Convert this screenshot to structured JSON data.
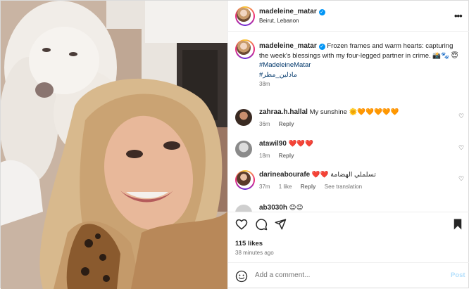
{
  "colors": {
    "accent": "#0095f6",
    "hashtag": "#00376b",
    "muted": "#737373",
    "heart": "#ed4956",
    "post_disabled": "#b2dffc"
  },
  "post": {
    "username": "madeleine_matar",
    "location": "Beirut, Lebanon",
    "more_icon": "•••"
  },
  "caption": {
    "username": "madeleine_matar",
    "text": "Frozen frames and warm hearts: capturing the week's blessings with my four-legged partner in crime. 📸🐾 😇",
    "hashtags": [
      "#MadeleineMatar",
      "#مادلين_مطر"
    ],
    "time": "38m"
  },
  "comments": [
    {
      "username": "zahraa.h.hallal",
      "text": "My sunshine 🌞🧡🧡🧡🧡🧡",
      "time": "36m",
      "likes": "",
      "reply": "Reply",
      "translate": ""
    },
    {
      "username": "atawil90",
      "text": "❤️❤️❤️",
      "time": "18m",
      "likes": "",
      "reply": "Reply",
      "translate": ""
    },
    {
      "username": "darineabourafe",
      "text": "❤️❤️ تسلملي الهضامة",
      "time": "37m",
      "likes": "1 like",
      "reply": "Reply",
      "translate": "See translation"
    },
    {
      "username": "ab3030h",
      "text": "😊😊",
      "time": "",
      "likes": "",
      "reply": "",
      "translate": ""
    }
  ],
  "actions": {
    "like_icon": "heart-outline-icon",
    "comment_icon": "comment-bubble-icon",
    "share_icon": "paper-plane-icon",
    "save_icon": "bookmark-icon"
  },
  "likes": "115 likes",
  "time_ago": "38 minutes ago",
  "add_comment": {
    "placeholder": "Add a comment...",
    "post_label": "Post"
  }
}
